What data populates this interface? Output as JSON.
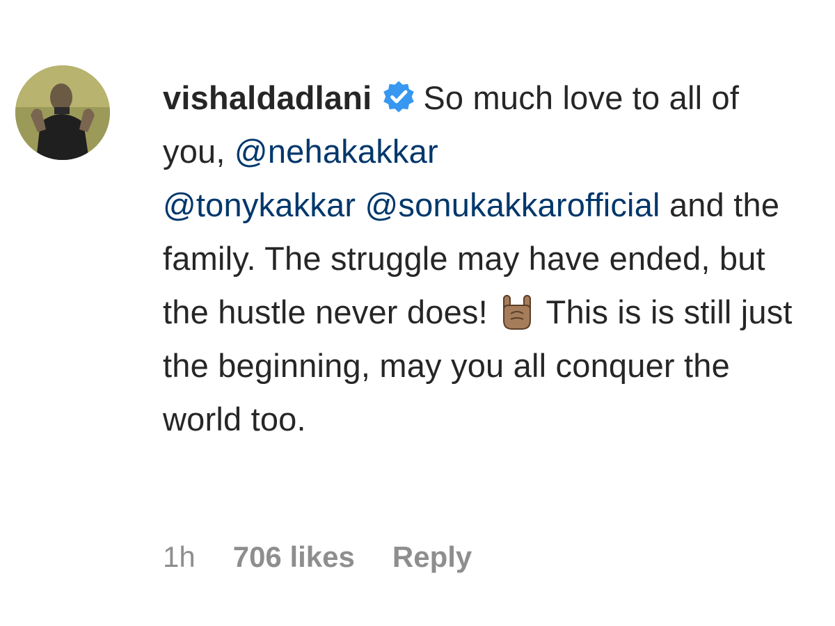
{
  "comment": {
    "username": "vishaldadlani",
    "verified": true,
    "text_segments": [
      {
        "type": "text",
        "value": "So much love to all of you, "
      },
      {
        "type": "mention",
        "value": "@nehakakkar"
      },
      {
        "type": "text",
        "value": " "
      },
      {
        "type": "mention",
        "value": "@tonykakkar"
      },
      {
        "type": "text",
        "value": " "
      },
      {
        "type": "mention",
        "value": "@sonukakkarofficial"
      },
      {
        "type": "text",
        "value": " and the family. The struggle may have ended, but the hustle never does! "
      },
      {
        "type": "emoji",
        "value": "🤘"
      },
      {
        "type": "text",
        "value": " This is is still just the beginning, may you all conquer the world too."
      }
    ],
    "time": "1h",
    "likes": "706 likes",
    "reply_label": "Reply"
  },
  "icons": {
    "verified": "verified-badge-icon",
    "emoji": "sign-of-the-horns-emoji"
  },
  "colors": {
    "text": "#262626",
    "mention": "#00376b",
    "meta": "#8e8e8e",
    "verified": "#3897f0"
  }
}
